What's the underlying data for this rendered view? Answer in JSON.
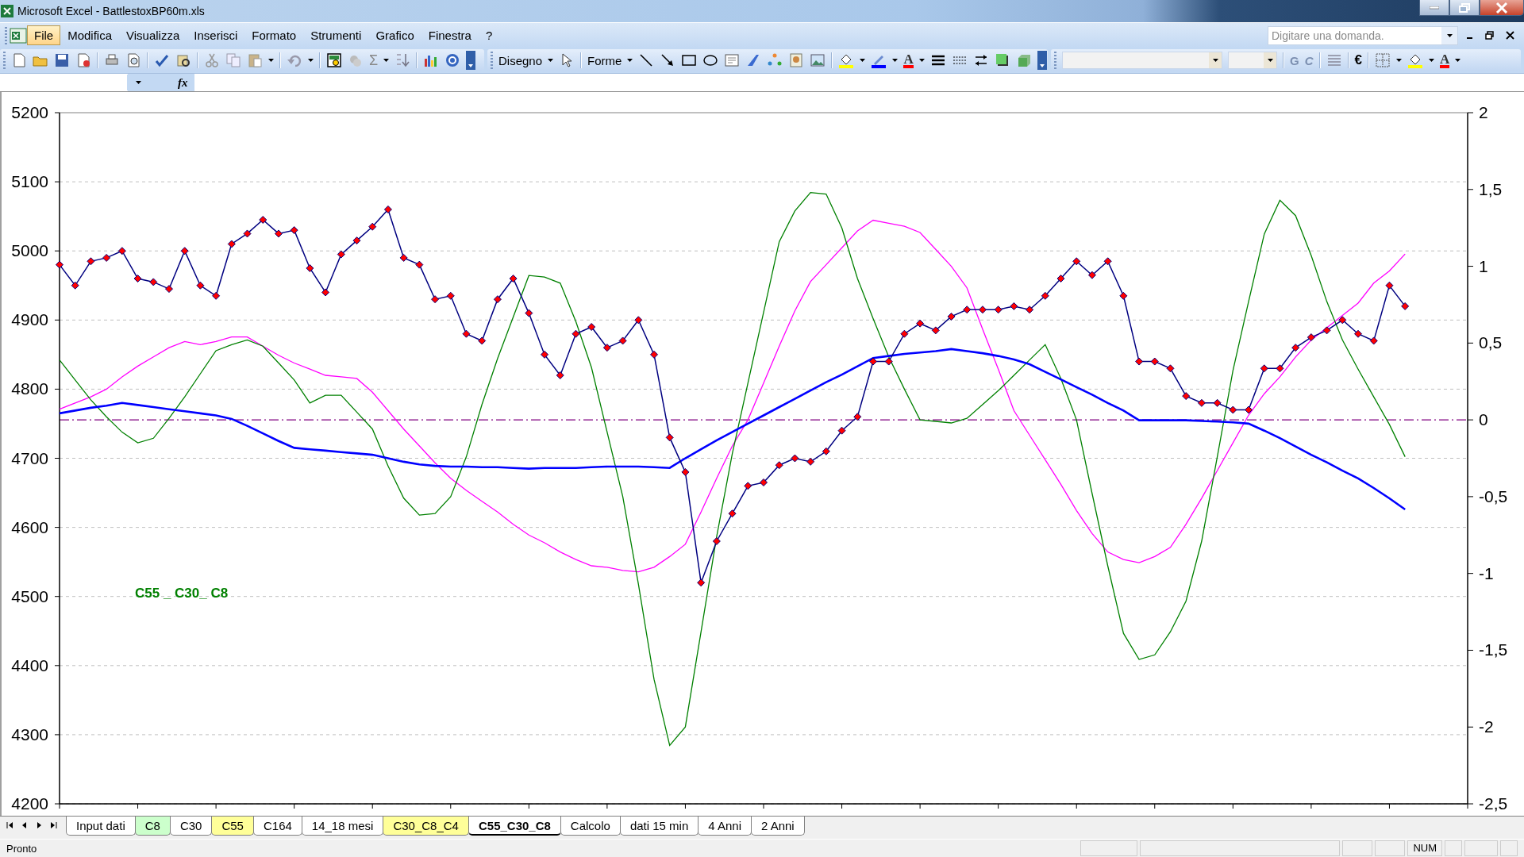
{
  "window": {
    "title": "Microsoft Excel - BattlestoxBP60m.xls"
  },
  "menu": [
    {
      "label": "File",
      "selected": true
    },
    {
      "label": "Modifica",
      "selected": false
    },
    {
      "label": "Visualizza",
      "selected": false
    },
    {
      "label": "Inserisci",
      "selected": false
    },
    {
      "label": "Formato",
      "selected": false
    },
    {
      "label": "Strumenti",
      "selected": false
    },
    {
      "label": "Grafico",
      "selected": false
    },
    {
      "label": "Finestra",
      "selected": false
    },
    {
      "label": "?",
      "selected": false
    }
  ],
  "help_search": {
    "placeholder": "Digitare una domanda."
  },
  "toolbars": {
    "standard": {
      "sum_button": "Σ"
    },
    "drawing": {
      "drawing_menu": "Disegno",
      "shapes_menu": "Forme",
      "font_color_button": "A"
    },
    "formatting": {
      "bold_button": "G",
      "italic_button": "C",
      "currency_button": "€",
      "font_color_button": "A"
    }
  },
  "formula_bar": {
    "function_label": "fx"
  },
  "chart": {
    "chart_data": {
      "type": "line",
      "ylim": [
        4200,
        5200
      ],
      "yticks": [
        4200,
        4300,
        4400,
        4500,
        4600,
        4700,
        4800,
        4900,
        5000,
        5100,
        5200
      ],
      "y2lim": [
        -2.5,
        2
      ],
      "y2ticks": [
        {
          "value": -2.5,
          "label": "-2,5"
        },
        {
          "value": -2,
          "label": "-2"
        },
        {
          "value": -1.5,
          "label": "-1,5"
        },
        {
          "value": -1,
          "label": "-1"
        },
        {
          "value": -0.5,
          "label": "-0,5"
        },
        {
          "value": 0,
          "label": "0"
        },
        {
          "value": 0.5,
          "label": "0,5"
        },
        {
          "value": 1,
          "label": "1"
        },
        {
          "value": 1.5,
          "label": "1,5"
        },
        {
          "value": 2,
          "label": "2"
        }
      ],
      "series": [
        {
          "axis": "y2",
          "color": "#ff00ff",
          "values": [
            0.07,
            0.11,
            0.15,
            0.2,
            0.28,
            0.35,
            0.41,
            0.47,
            0.51,
            0.49,
            0.51,
            0.54,
            0.54,
            0.48,
            0.42,
            0.37,
            0.33,
            0.29,
            0.28,
            0.27,
            0.18,
            0.06,
            -0.06,
            -0.17,
            -0.28,
            -0.38,
            -0.46,
            -0.53,
            -0.6,
            -0.68,
            -0.75,
            -0.8,
            -0.86,
            -0.91,
            -0.95,
            -0.96,
            -0.98,
            -0.99,
            -0.96,
            -0.89,
            -0.81,
            -0.6,
            -0.38,
            -0.17,
            0,
            0.24,
            0.48,
            0.71,
            0.9,
            1.01,
            1.12,
            1.23,
            1.3,
            1.28,
            1.26,
            1.22,
            1.11,
            1.0,
            0.86,
            0.59,
            0.33,
            0.06,
            -0.1,
            -0.26,
            -0.42,
            -0.59,
            -0.74,
            -0.86,
            -0.91,
            -0.93,
            -0.89,
            -0.83,
            -0.68,
            -0.51,
            -0.33,
            -0.15,
            0.03,
            0.17,
            0.28,
            0.41,
            0.52,
            0.6,
            0.68,
            0.76,
            0.89,
            0.97,
            1.08
          ]
        },
        {
          "axis": "y2",
          "color": "#008000",
          "values": [
            0.39,
            0.26,
            0.13,
            0.02,
            -0.08,
            -0.15,
            -0.12,
            0.01,
            0.15,
            0.3,
            0.45,
            0.49,
            0.52,
            0.48,
            0.37,
            0.26,
            0.11,
            0.16,
            0.16,
            0.05,
            -0.06,
            -0.3,
            -0.51,
            -0.62,
            -0.61,
            -0.5,
            -0.24,
            0.1,
            0.4,
            0.67,
            0.94,
            0.93,
            0.89,
            0.64,
            0.34,
            -0.08,
            -0.5,
            -1.07,
            -1.69,
            -2.12,
            -2.0,
            -1.38,
            -0.76,
            -0.22,
            0.24,
            0.7,
            1.16,
            1.36,
            1.48,
            1.47,
            1.25,
            0.92,
            0.66,
            0.41,
            0.2,
            0,
            -0.01,
            -0.02,
            0.01,
            0.1,
            0.19,
            0.29,
            0.39,
            0.49,
            0.27,
            0,
            -0.48,
            -0.95,
            -1.39,
            -1.56,
            -1.53,
            -1.38,
            -1.18,
            -0.79,
            -0.24,
            0.32,
            0.77,
            1.21,
            1.43,
            1.33,
            1.07,
            0.77,
            0.52,
            0.33,
            0.15,
            -0.03,
            -0.24
          ]
        },
        {
          "color": "#0000ff",
          "values": [
            4765,
            4769,
            4773,
            4776,
            4780,
            4777,
            4774,
            4771,
            4768,
            4765,
            4762,
            4757,
            4747,
            4736,
            4725,
            4715,
            4713,
            4711,
            4709,
            4707,
            4705,
            4700,
            4695,
            4691,
            4689,
            4688,
            4688,
            4687,
            4687,
            4686,
            4685,
            4686,
            4686,
            4686,
            4687,
            4688,
            4688,
            4688,
            4687,
            4686,
            4700,
            4713,
            4726,
            4738,
            4750,
            4762,
            4774,
            4786,
            4798,
            4810,
            4821,
            4833,
            4845,
            4848,
            4851,
            4853,
            4855,
            4858,
            4855,
            4852,
            4848,
            4843,
            4836,
            4825,
            4814,
            4803,
            4792,
            4780,
            4769,
            4755,
            4755,
            4755,
            4755,
            4754,
            4753,
            4752,
            4750,
            4740,
            4729,
            4717,
            4705,
            4694,
            4682,
            4671,
            4657,
            4642,
            4626
          ]
        },
        {
          "color": "#000080",
          "marker": "diamond",
          "values": [
            4980,
            4950,
            4985,
            4990,
            5000,
            4960,
            4955,
            4945,
            5000,
            4950,
            4935,
            5010,
            5025,
            5045,
            5025,
            5030,
            4975,
            4940,
            4995,
            5015,
            5035,
            5060,
            4990,
            4980,
            4930,
            4935,
            4880,
            4870,
            4930,
            4960,
            4910,
            4850,
            4820,
            4880,
            4890,
            4860,
            4870,
            4900,
            4850,
            4730,
            4680,
            4520,
            4580,
            4620,
            4660,
            4665,
            4690,
            4700,
            4695,
            4710,
            4740,
            4760,
            4840,
            4840,
            4880,
            4895,
            4885,
            4905,
            4915,
            4915,
            4915,
            4920,
            4915,
            4935,
            4960,
            4985,
            4965,
            4985,
            4935,
            4840,
            4840,
            4830,
            4790,
            4780,
            4780,
            4770,
            4770,
            4830,
            4830,
            4860,
            4875,
            4885,
            4900,
            4880,
            4870,
            4950,
            4920
          ]
        }
      ],
      "annotations": [
        "C55 _ C30_ C8"
      ],
      "grid": true,
      "ref_lines": [
        {
          "value": 0,
          "axis": "y2",
          "color": "#800080"
        }
      ]
    }
  },
  "sheet_tabs": [
    {
      "label": "Input dati",
      "selected": false
    },
    {
      "label": "C8",
      "selected": false,
      "color": "#ccffcc"
    },
    {
      "label": "C30",
      "selected": false
    },
    {
      "label": "C55",
      "selected": false,
      "color": "#ffff99"
    },
    {
      "label": "C164",
      "selected": false
    },
    {
      "label": "14_18 mesi",
      "selected": false
    },
    {
      "label": "C30_C8_C4",
      "selected": false,
      "color": "#ffff99"
    },
    {
      "label": "C55_C30_C8",
      "selected": true
    },
    {
      "label": "Calcolo",
      "selected": false
    },
    {
      "label": "dati 15 min",
      "selected": false
    },
    {
      "label": "4 Anni",
      "selected": false
    },
    {
      "label": "2 Anni",
      "selected": false
    }
  ],
  "status_bar": {
    "mode": "Pronto",
    "indicator": "NUM"
  }
}
